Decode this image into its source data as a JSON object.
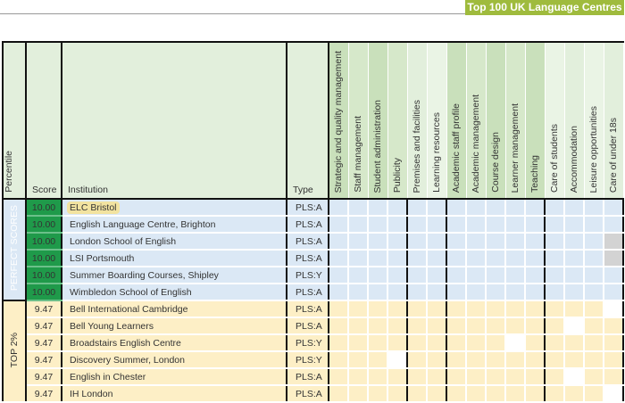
{
  "brand": "Top 100 UK Language Centres",
  "headers": {
    "percentile": "Percentile",
    "score": "Score",
    "institution": "Institution",
    "type": "Type"
  },
  "criteria": [
    "Strategic and quality management",
    "Staff management",
    "Student administration",
    "Publicity",
    "Premises and facilities",
    "Learning resources",
    "Academic staff profile",
    "Academic management",
    "Course design",
    "Learner management",
    "Teaching",
    "Care of students",
    "Accommodation",
    "Leisure opportunities",
    "Care of under 18s"
  ],
  "groups": [
    {
      "label": "PERFECT SCORES",
      "rows": [
        {
          "score": "10.00",
          "name": "ELC Bristol",
          "type": "PLS:A",
          "highlight": true,
          "white": [],
          "gray": []
        },
        {
          "score": "10.00",
          "name": "English Language Centre, Brighton",
          "type": "PLS:A",
          "white": [],
          "gray": []
        },
        {
          "score": "10.00",
          "name": "London School of English",
          "type": "PLS:A",
          "white": [],
          "gray": [
            14
          ]
        },
        {
          "score": "10.00",
          "name": "LSI Portsmouth",
          "type": "PLS:A",
          "white": [],
          "gray": [
            14
          ]
        },
        {
          "score": "10.00",
          "name": "Summer Boarding Courses, Shipley",
          "type": "PLS:Y",
          "white": [],
          "gray": []
        },
        {
          "score": "10.00",
          "name": "Wimbledon School of English",
          "type": "PLS:A",
          "white": [],
          "gray": []
        }
      ]
    },
    {
      "label": "TOP 2%",
      "rows": [
        {
          "score": "9.47",
          "name": "Bell International Cambridge",
          "type": "PLS:A",
          "white": [
            14
          ],
          "gray": []
        },
        {
          "score": "9.47",
          "name": "Bell Young Learners",
          "type": "PLS:A",
          "white": [
            12
          ],
          "gray": []
        },
        {
          "score": "9.47",
          "name": "Broadstairs English Centre",
          "type": "PLS:Y",
          "white": [
            9
          ],
          "gray": []
        },
        {
          "score": "9.47",
          "name": "Discovery Summer, London",
          "type": "PLS:Y",
          "white": [
            3
          ],
          "gray": []
        },
        {
          "score": "9.47",
          "name": "English in Chester",
          "type": "PLS:A",
          "white": [
            12
          ],
          "gray": []
        },
        {
          "score": "9.47",
          "name": "IH London",
          "type": "PLS:A",
          "white": [
            14
          ],
          "gray": []
        }
      ]
    }
  ]
}
